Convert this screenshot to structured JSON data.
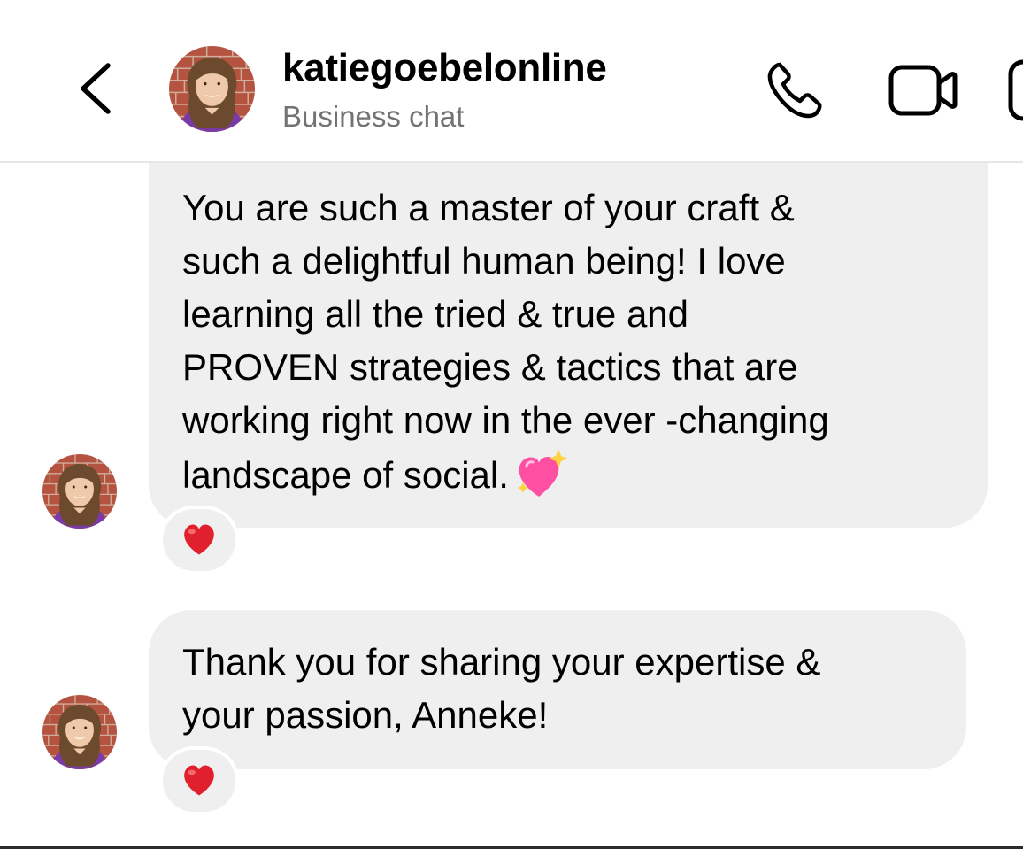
{
  "header": {
    "back_icon": "chevron-left-icon",
    "username": "katiegoebelonline",
    "subtitle": "Business chat",
    "call_icon": "phone-icon",
    "video_icon": "video-camera-icon"
  },
  "messages": [
    {
      "text": "You are such a master of your craft &\nsuch a delightful human being! I love\nlearning all the tried & true and\nPROVEN strategies & tactics that are\nworking right now in the ever -changing\nlandscape of social.",
      "inline_emoji": "sparkling-heart-icon",
      "reaction": "red-heart-icon"
    },
    {
      "text": "Thank you for sharing your expertise &\nyour passion, Anneke!",
      "reaction": "red-heart-icon"
    }
  ],
  "colors": {
    "bubble": "#efefef",
    "subtitle": "#737373",
    "heart": "#e0202d",
    "sparkle_heart": "#ff4fa3"
  }
}
